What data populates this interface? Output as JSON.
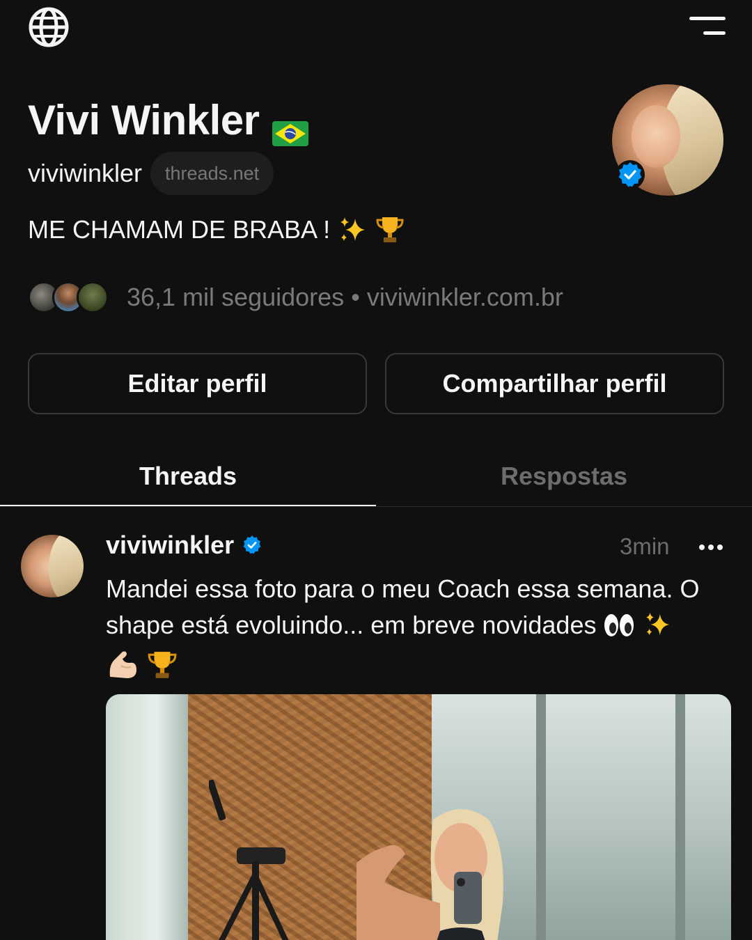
{
  "header": {
    "globe_icon": "globe-icon",
    "menu_icon": "menu-icon"
  },
  "profile": {
    "display_name": "Vivi Winkler",
    "flag_icon": "brazil-flag",
    "username": "viviwinkler",
    "domain_badge": "threads.net",
    "verified": true,
    "bio_text": "ME CHAMAM DE BRABA !",
    "bio_emojis": [
      "sparkles",
      "trophy"
    ],
    "followers": "36,1 mil seguidores",
    "separator": "•",
    "link": "viviwinkler.com.br"
  },
  "actions": {
    "edit_label": "Editar perfil",
    "share_label": "Compartilhar perfil"
  },
  "tabs": [
    {
      "label": "Threads",
      "active": true
    },
    {
      "label": "Respostas",
      "active": false
    }
  ],
  "post": {
    "username": "viviwinkler",
    "verified": true,
    "time": "3min",
    "more_icon": "more-icon",
    "text_line1": "Mandei essa foto para o meu Coach essa semana. O shape está evoluindo... em breve novidades",
    "emojis": [
      "eyes",
      "sparkles",
      "flexed-biceps",
      "trophy"
    ]
  },
  "colors": {
    "background": "#101010",
    "text": "#f3f5f7",
    "muted": "#7a7a7a",
    "border": "#383838",
    "verified_blue": "#0095f6"
  }
}
